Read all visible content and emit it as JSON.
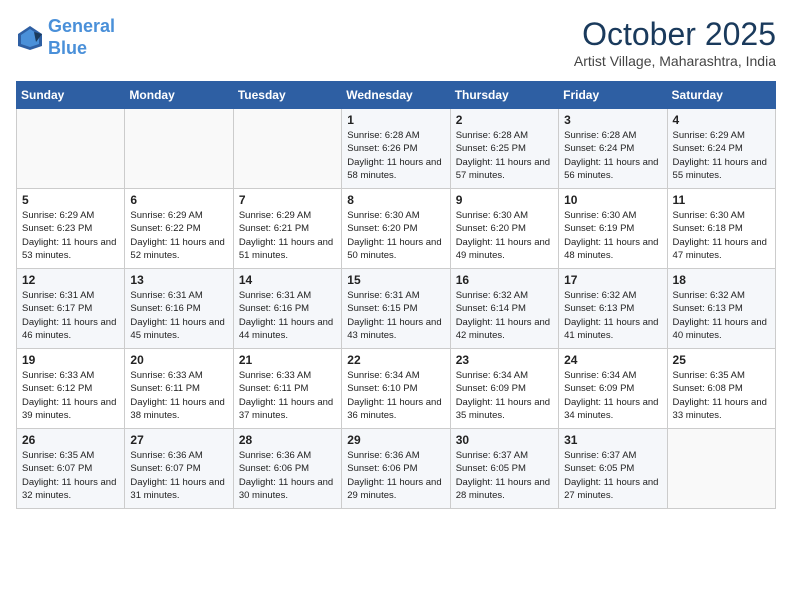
{
  "header": {
    "logo_line1": "General",
    "logo_line2": "Blue",
    "month": "October 2025",
    "location": "Artist Village, Maharashtra, India"
  },
  "weekdays": [
    "Sunday",
    "Monday",
    "Tuesday",
    "Wednesday",
    "Thursday",
    "Friday",
    "Saturday"
  ],
  "weeks": [
    [
      {
        "day": "",
        "info": ""
      },
      {
        "day": "",
        "info": ""
      },
      {
        "day": "",
        "info": ""
      },
      {
        "day": "1",
        "info": "Sunrise: 6:28 AM\nSunset: 6:26 PM\nDaylight: 11 hours\nand 58 minutes."
      },
      {
        "day": "2",
        "info": "Sunrise: 6:28 AM\nSunset: 6:25 PM\nDaylight: 11 hours\nand 57 minutes."
      },
      {
        "day": "3",
        "info": "Sunrise: 6:28 AM\nSunset: 6:24 PM\nDaylight: 11 hours\nand 56 minutes."
      },
      {
        "day": "4",
        "info": "Sunrise: 6:29 AM\nSunset: 6:24 PM\nDaylight: 11 hours\nand 55 minutes."
      }
    ],
    [
      {
        "day": "5",
        "info": "Sunrise: 6:29 AM\nSunset: 6:23 PM\nDaylight: 11 hours\nand 53 minutes."
      },
      {
        "day": "6",
        "info": "Sunrise: 6:29 AM\nSunset: 6:22 PM\nDaylight: 11 hours\nand 52 minutes."
      },
      {
        "day": "7",
        "info": "Sunrise: 6:29 AM\nSunset: 6:21 PM\nDaylight: 11 hours\nand 51 minutes."
      },
      {
        "day": "8",
        "info": "Sunrise: 6:30 AM\nSunset: 6:20 PM\nDaylight: 11 hours\nand 50 minutes."
      },
      {
        "day": "9",
        "info": "Sunrise: 6:30 AM\nSunset: 6:20 PM\nDaylight: 11 hours\nand 49 minutes."
      },
      {
        "day": "10",
        "info": "Sunrise: 6:30 AM\nSunset: 6:19 PM\nDaylight: 11 hours\nand 48 minutes."
      },
      {
        "day": "11",
        "info": "Sunrise: 6:30 AM\nSunset: 6:18 PM\nDaylight: 11 hours\nand 47 minutes."
      }
    ],
    [
      {
        "day": "12",
        "info": "Sunrise: 6:31 AM\nSunset: 6:17 PM\nDaylight: 11 hours\nand 46 minutes."
      },
      {
        "day": "13",
        "info": "Sunrise: 6:31 AM\nSunset: 6:16 PM\nDaylight: 11 hours\nand 45 minutes."
      },
      {
        "day": "14",
        "info": "Sunrise: 6:31 AM\nSunset: 6:16 PM\nDaylight: 11 hours\nand 44 minutes."
      },
      {
        "day": "15",
        "info": "Sunrise: 6:31 AM\nSunset: 6:15 PM\nDaylight: 11 hours\nand 43 minutes."
      },
      {
        "day": "16",
        "info": "Sunrise: 6:32 AM\nSunset: 6:14 PM\nDaylight: 11 hours\nand 42 minutes."
      },
      {
        "day": "17",
        "info": "Sunrise: 6:32 AM\nSunset: 6:13 PM\nDaylight: 11 hours\nand 41 minutes."
      },
      {
        "day": "18",
        "info": "Sunrise: 6:32 AM\nSunset: 6:13 PM\nDaylight: 11 hours\nand 40 minutes."
      }
    ],
    [
      {
        "day": "19",
        "info": "Sunrise: 6:33 AM\nSunset: 6:12 PM\nDaylight: 11 hours\nand 39 minutes."
      },
      {
        "day": "20",
        "info": "Sunrise: 6:33 AM\nSunset: 6:11 PM\nDaylight: 11 hours\nand 38 minutes."
      },
      {
        "day": "21",
        "info": "Sunrise: 6:33 AM\nSunset: 6:11 PM\nDaylight: 11 hours\nand 37 minutes."
      },
      {
        "day": "22",
        "info": "Sunrise: 6:34 AM\nSunset: 6:10 PM\nDaylight: 11 hours\nand 36 minutes."
      },
      {
        "day": "23",
        "info": "Sunrise: 6:34 AM\nSunset: 6:09 PM\nDaylight: 11 hours\nand 35 minutes."
      },
      {
        "day": "24",
        "info": "Sunrise: 6:34 AM\nSunset: 6:09 PM\nDaylight: 11 hours\nand 34 minutes."
      },
      {
        "day": "25",
        "info": "Sunrise: 6:35 AM\nSunset: 6:08 PM\nDaylight: 11 hours\nand 33 minutes."
      }
    ],
    [
      {
        "day": "26",
        "info": "Sunrise: 6:35 AM\nSunset: 6:07 PM\nDaylight: 11 hours\nand 32 minutes."
      },
      {
        "day": "27",
        "info": "Sunrise: 6:36 AM\nSunset: 6:07 PM\nDaylight: 11 hours\nand 31 minutes."
      },
      {
        "day": "28",
        "info": "Sunrise: 6:36 AM\nSunset: 6:06 PM\nDaylight: 11 hours\nand 30 minutes."
      },
      {
        "day": "29",
        "info": "Sunrise: 6:36 AM\nSunset: 6:06 PM\nDaylight: 11 hours\nand 29 minutes."
      },
      {
        "day": "30",
        "info": "Sunrise: 6:37 AM\nSunset: 6:05 PM\nDaylight: 11 hours\nand 28 minutes."
      },
      {
        "day": "31",
        "info": "Sunrise: 6:37 AM\nSunset: 6:05 PM\nDaylight: 11 hours\nand 27 minutes."
      },
      {
        "day": "",
        "info": ""
      }
    ]
  ]
}
